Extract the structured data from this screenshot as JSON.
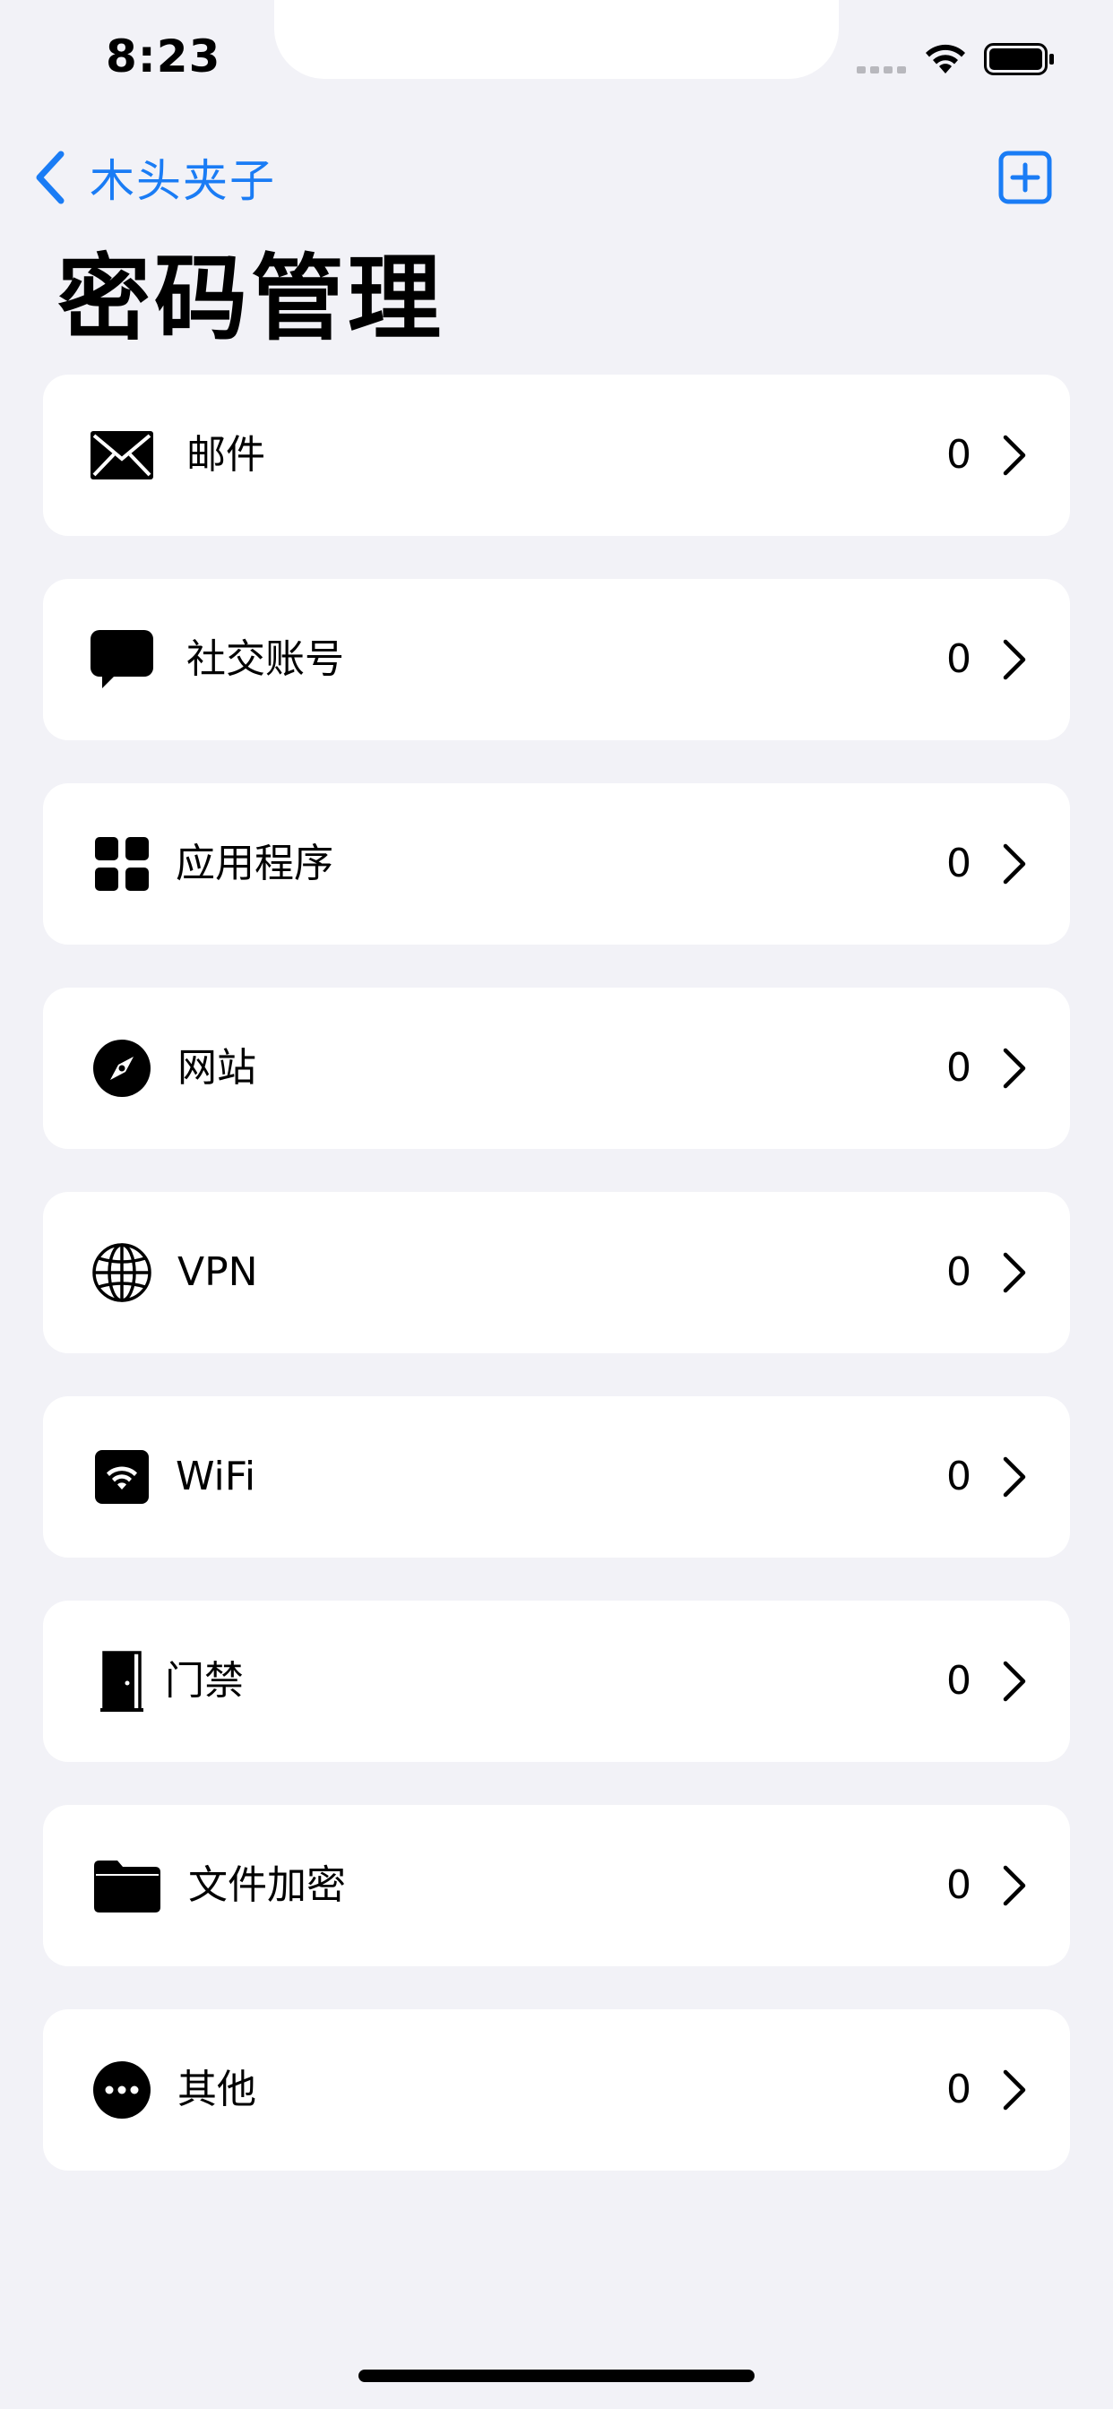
{
  "status_bar": {
    "time": "8:23"
  },
  "nav": {
    "back_label": "木头夹子",
    "accent_color": "#1a7cf5"
  },
  "page": {
    "title": "密码管理"
  },
  "categories": [
    {
      "label": "邮件",
      "count": "0",
      "icon": "envelope-icon"
    },
    {
      "label": "社交账号",
      "count": "0",
      "icon": "chat-bubble-icon"
    },
    {
      "label": "应用程序",
      "count": "0",
      "icon": "app-grid-icon"
    },
    {
      "label": "网站",
      "count": "0",
      "icon": "compass-icon"
    },
    {
      "label": "VPN",
      "count": "0",
      "icon": "globe-icon"
    },
    {
      "label": "WiFi",
      "count": "0",
      "icon": "wifi-square-icon"
    },
    {
      "label": "门禁",
      "count": "0",
      "icon": "door-icon"
    },
    {
      "label": "文件加密",
      "count": "0",
      "icon": "folder-icon"
    },
    {
      "label": "其他",
      "count": "0",
      "icon": "ellipsis-circle-icon"
    }
  ]
}
